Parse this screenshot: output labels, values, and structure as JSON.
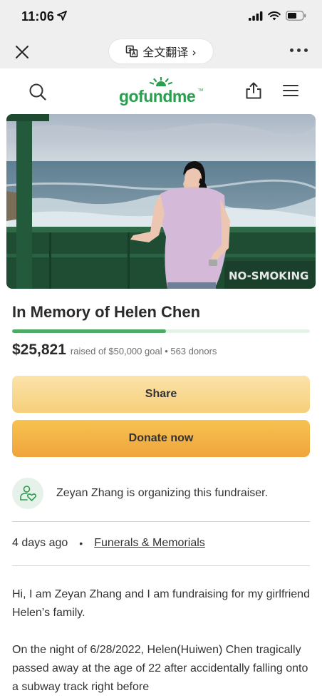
{
  "status_bar": {
    "time": "11:06",
    "icons": [
      "location-arrow-icon",
      "cellular-signal-icon",
      "wifi-icon",
      "battery-icon"
    ]
  },
  "browser_bar": {
    "translate_label": "全文翻译 ›",
    "icons": [
      "close-icon",
      "translate-icon",
      "more-icon"
    ]
  },
  "site_header": {
    "logo_text": "gofundme",
    "logo_tm": "TM",
    "icons": [
      "search-icon",
      "share-icon",
      "hamburger-menu-icon"
    ]
  },
  "campaign": {
    "title": "In Memory of Helen Chen",
    "raised_amount": "$25,821",
    "raised_meta": "raised of $50,000 goal • 563 donors",
    "progress_fraction": 0.516,
    "hero_sign_text": "NO-SMOKING"
  },
  "buttons": {
    "share": "Share",
    "donate": "Donate now"
  },
  "organizer": {
    "text": "Zeyan Zhang is organizing this fundraiser.",
    "icon": "organizer-heart-person-icon"
  },
  "meta": {
    "age": "4 days ago",
    "separator": "•",
    "category": "Funerals & Memorials"
  },
  "story": {
    "paragraph_1": "Hi, I am Zeyan Zhang and I am fundraising for my girlfriend Helen’s family.",
    "paragraph_2": "On the night of 6/28/2022, Helen(Huiwen) Chen tragically passed away at the age of 22 after accidentally falling onto a subway track right before"
  },
  "colors": {
    "brand_green": "#2a9d4e",
    "progress_green": "#4eab66",
    "share_button": "#f6cf7a",
    "donate_button": "#f0a43c",
    "chrome_gray": "#efefef"
  }
}
